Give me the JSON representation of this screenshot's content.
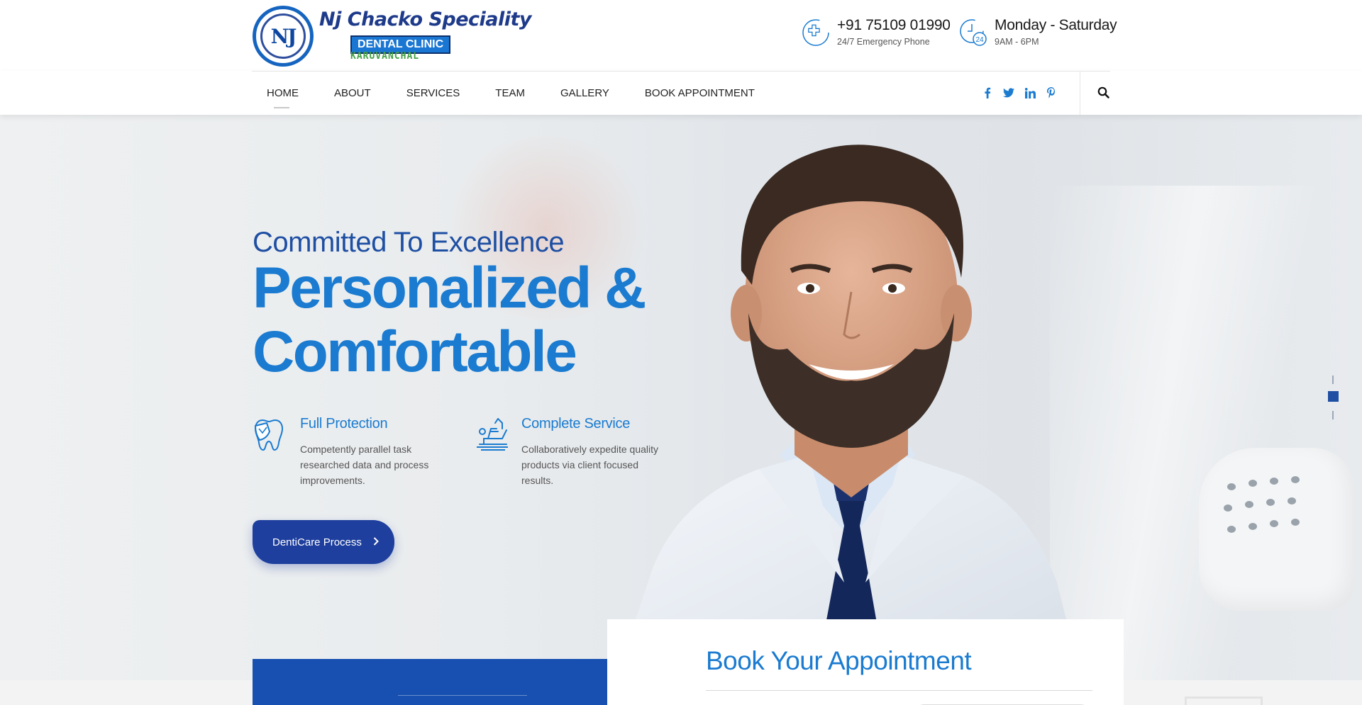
{
  "brand": {
    "logo_initials": "NJ",
    "name": "Nj Chacko Speciality",
    "badge": "DENTAL CLINIC",
    "location": "KARUVANCHAL"
  },
  "contact": {
    "phone": {
      "number": "+91 75109 01990",
      "label": "24/7 Emergency Phone",
      "icon": "phone-cross-icon"
    },
    "hours": {
      "days": "Monday - Saturday",
      "time": "9AM - 6PM",
      "icon": "clock-24-icon"
    }
  },
  "nav": {
    "items": [
      {
        "label": "HOME",
        "active": true
      },
      {
        "label": "ABOUT",
        "active": false
      },
      {
        "label": "SERVICES",
        "active": false
      },
      {
        "label": "TEAM",
        "active": false
      },
      {
        "label": "GALLERY",
        "active": false
      },
      {
        "label": "BOOK APPOINTMENT",
        "active": false
      }
    ],
    "social": [
      "facebook-icon",
      "twitter-icon",
      "linkedin-icon",
      "pinterest-icon"
    ],
    "search_icon": "search-icon"
  },
  "hero": {
    "tagline": "Committed To Excellence",
    "headline_line1": "Personalized &",
    "headline_line2": "Comfortable",
    "features": [
      {
        "title": "Full Protection",
        "text": "Competently parallel task researched data and process improvements.",
        "icon": "tooth-shield-icon"
      },
      {
        "title": "Complete Service",
        "text": "Collaboratively expedite quality products via client focused results.",
        "icon": "dental-chair-icon"
      }
    ],
    "cta_label": "DentiCare Process",
    "slider": {
      "total": 3,
      "active": 2
    }
  },
  "appointment": {
    "title": "Book Your Appointment"
  },
  "colors": {
    "primary_blue": "#1a7bd0",
    "dark_blue": "#1e3f9e",
    "panel_blue": "#1750b0",
    "logo_green": "#43a047"
  }
}
